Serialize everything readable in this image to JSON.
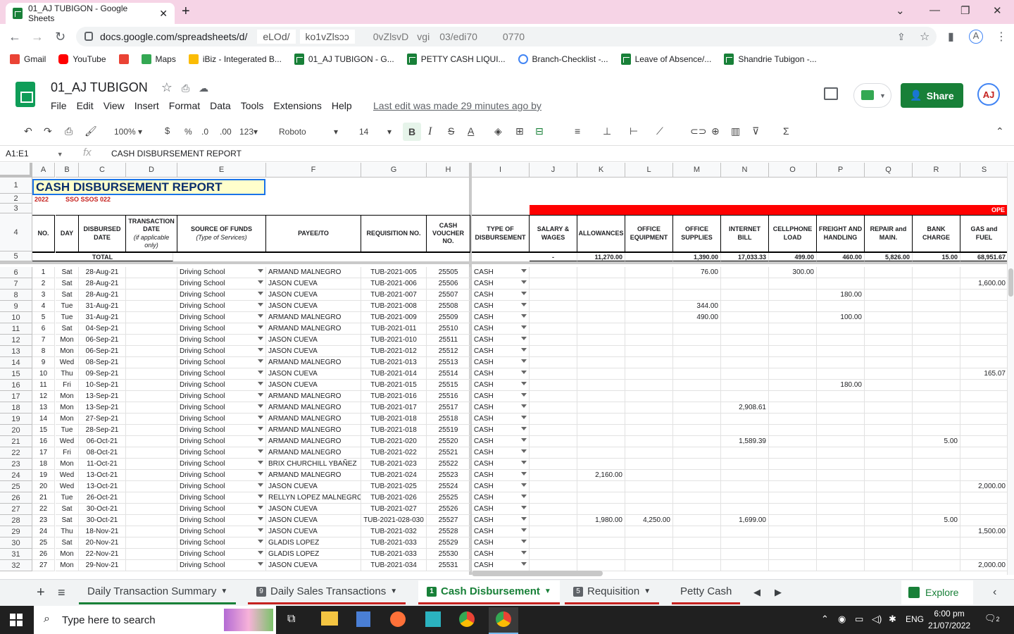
{
  "browser": {
    "tab_title": "01_AJ TUBIGON - Google Sheets",
    "url": "docs.google.com/spreadsheets/d/",
    "url_fragments": [
      "eLOd/",
      "ko1vZlsɔɔ",
      "0vZlsvD",
      "vgi",
      "03/edi70",
      "0770"
    ],
    "bookmarks": [
      "Gmail",
      "YouTube",
      "Maps",
      "iBiz - Integerated B...",
      "01_AJ TUBIGON - G...",
      "PETTY CASH LIQUI...",
      "Branch-Checklist -...",
      "Leave of Absence/...",
      "Shandrie Tubigon -..."
    ]
  },
  "doc": {
    "title": "01_AJ TUBIGON",
    "menus": [
      "File",
      "Edit",
      "View",
      "Insert",
      "Format",
      "Data",
      "Tools",
      "Extensions",
      "Help"
    ],
    "last_edit": "Last edit was made 29 minutes ago by",
    "share": "Share",
    "avatar": "AJ"
  },
  "toolbar": {
    "zoom": "100%",
    "currency": "$",
    "percent": "%",
    "dec_less": ".0",
    "dec_more": ".00",
    "format123": "123",
    "font": "Roboto",
    "size": "14"
  },
  "formula": {
    "namebox": "A1:E1",
    "fx": "fx",
    "content": "CASH DISBURSEMENT REPORT"
  },
  "columns": [
    "A",
    "B",
    "C",
    "D",
    "E",
    "F",
    "G",
    "H",
    "I",
    "J",
    "K",
    "L",
    "M",
    "N",
    "O",
    "P",
    "Q",
    "R",
    "S"
  ],
  "sheet": {
    "title": "CASH DISBURSEMENT REPORT",
    "row2": "2022",
    "row2b": "SSO SSOS 022",
    "ope": "OPE",
    "headers": {
      "no": "NO.",
      "day": "DAY",
      "disbursed": "DISBURSED DATE",
      "transaction": "TRANSACTION DATE",
      "transaction_note": "(if applicable only)",
      "source": "SOURCE OF FUNDS",
      "source_note": "(Type of Services)",
      "payee": "PAYEE/TO",
      "req": "REQUISITION NO.",
      "voucher": "CASH VOUCHER NO.",
      "type": "TYPE OF DISBURSEMENT",
      "salary": "SALARY & WAGES",
      "allow": "ALLOWANCES",
      "equip": "OFFICE EQUIPMENT",
      "supplies": "OFFICE SUPPLIES",
      "internet": "INTERNET BILL",
      "cell": "CELLPHONE LOAD",
      "freight": "FREIGHT AND HANDLING",
      "repair": "REPAIR and MAIN.",
      "bank": "BANK CHARGE",
      "gas": "GAS and FUEL"
    },
    "total_label": "TOTAL",
    "totals": {
      "J": "-",
      "K": "11,270.00",
      "L": "",
      "M": "1,390.00",
      "N": "17,033.33",
      "O": "499.00",
      "P": "460.00",
      "Q": "5,826.00",
      "R": "15.00",
      "S": "68,951.67"
    },
    "rows": [
      {
        "n": "6",
        "no": "1",
        "day": "Sat",
        "date": "28-Aug-21",
        "src": "Driving School",
        "payee": "ARMAND  MALNEGRO",
        "req": "TUB-2021-005",
        "cv": "25505",
        "type": "CASH",
        "M": "76.00",
        "O": "300.00"
      },
      {
        "n": "7",
        "no": "2",
        "day": "Sat",
        "date": "28-Aug-21",
        "src": "Driving School",
        "payee": "JASON CUEVA",
        "req": "TUB-2021-006",
        "cv": "25506",
        "type": "CASH",
        "S": "1,600.00"
      },
      {
        "n": "8",
        "no": "3",
        "day": "Sat",
        "date": "28-Aug-21",
        "src": "Driving School",
        "payee": "JASON CUEVA",
        "req": "TUB-2021-007",
        "cv": "25507",
        "type": "CASH",
        "P": "180.00"
      },
      {
        "n": "9",
        "no": "4",
        "day": "Tue",
        "date": "31-Aug-21",
        "src": "Driving School",
        "payee": "JASON CUEVA",
        "req": "TUB-2021-008",
        "cv": "25508",
        "type": "CASH",
        "M": "344.00"
      },
      {
        "n": "10",
        "no": "5",
        "day": "Tue",
        "date": "31-Aug-21",
        "src": "Driving School",
        "payee": "ARMAND MALNEGRO",
        "req": "TUB-2021-009",
        "cv": "25509",
        "type": "CASH",
        "M": "490.00",
        "P": "100.00"
      },
      {
        "n": "11",
        "no": "6",
        "day": "Sat",
        "date": "04-Sep-21",
        "src": "Driving School",
        "payee": "ARMAND MALNEGRO",
        "req": "TUB-2021-011",
        "cv": "25510",
        "type": "CASH"
      },
      {
        "n": "12",
        "no": "7",
        "day": "Mon",
        "date": "06-Sep-21",
        "src": "Driving School",
        "payee": "JASON CUEVA",
        "req": "TUB-2021-010",
        "cv": "25511",
        "type": "CASH"
      },
      {
        "n": "13",
        "no": "8",
        "day": "Mon",
        "date": "06-Sep-21",
        "src": "Driving School",
        "payee": "JASON CUEVA",
        "req": "TUB-2021-012",
        "cv": "25512",
        "type": "CASH"
      },
      {
        "n": "14",
        "no": "9",
        "day": "Wed",
        "date": "08-Sep-21",
        "src": "Driving School",
        "payee": "ARMAND MALNEGRO",
        "req": "TUB-2021-013",
        "cv": "25513",
        "type": "CASH"
      },
      {
        "n": "15",
        "no": "10",
        "day": "Thu",
        "date": "09-Sep-21",
        "src": "Driving School",
        "payee": "JASON CUEVA",
        "req": "TUB-2021-014",
        "cv": "25514",
        "type": "CASH",
        "S": "165.07"
      },
      {
        "n": "16",
        "no": "11",
        "day": "Fri",
        "date": "10-Sep-21",
        "src": "Driving School",
        "payee": "JASON CUEVA",
        "req": "TUB-2021-015",
        "cv": "25515",
        "type": "CASH",
        "P": "180.00"
      },
      {
        "n": "17",
        "no": "12",
        "day": "Mon",
        "date": "13-Sep-21",
        "src": "Driving School",
        "payee": "ARMAND MALNEGRO",
        "req": "TUB-2021-016",
        "cv": "25516",
        "type": "CASH"
      },
      {
        "n": "18",
        "no": "13",
        "day": "Mon",
        "date": "13-Sep-21",
        "src": "Driving School",
        "payee": "ARMAND MALNEGRO",
        "req": "TUB-2021-017",
        "cv": "25517",
        "type": "CASH",
        "N": "2,908.61"
      },
      {
        "n": "19",
        "no": "14",
        "day": "Mon",
        "date": "27-Sep-21",
        "src": "Driving School",
        "payee": "ARMAND MALNEGRO",
        "req": "TUB-2021-018",
        "cv": "25518",
        "type": "CASH"
      },
      {
        "n": "20",
        "no": "15",
        "day": "Tue",
        "date": "28-Sep-21",
        "src": "Driving School",
        "payee": "ARMAND MALNEGRO",
        "req": "TUB-2021-018",
        "cv": "25519",
        "type": "CASH"
      },
      {
        "n": "21",
        "no": "16",
        "day": "Wed",
        "date": "06-Oct-21",
        "src": "Driving School",
        "payee": "ARMAND MALNEGRO",
        "req": "TUB-2021-020",
        "cv": "25520",
        "type": "CASH",
        "N": "1,589.39",
        "R": "5.00"
      },
      {
        "n": "22",
        "no": "17",
        "day": "Fri",
        "date": "08-Oct-21",
        "src": "Driving School",
        "payee": "ARMAND MALNEGRO",
        "req": "TUB-2021-022",
        "cv": "25521",
        "type": "CASH"
      },
      {
        "n": "23",
        "no": "18",
        "day": "Mon",
        "date": "11-Oct-21",
        "src": "Driving School",
        "payee": "BRIX CHURCHILL YBAÑEZ",
        "req": "TUB-2021-023",
        "cv": "25522",
        "type": "CASH"
      },
      {
        "n": "24",
        "no": "19",
        "day": "Wed",
        "date": "13-Oct-21",
        "src": "Driving School",
        "payee": "ARMAND MALNEGRO",
        "req": "TUB-2021-024",
        "cv": "25523",
        "type": "CASH",
        "K": "2,160.00"
      },
      {
        "n": "25",
        "no": "20",
        "day": "Wed",
        "date": "13-Oct-21",
        "src": "Driving School",
        "payee": "JASON CUEVA",
        "req": "TUB-2021-025",
        "cv": "25524",
        "type": "CASH",
        "S": "2,000.00"
      },
      {
        "n": "26",
        "no": "21",
        "day": "Tue",
        "date": "26-Oct-21",
        "src": "Driving School",
        "payee": "RELLYN LOPEZ MALNEGRO",
        "req": "TUB-2021-026",
        "cv": "25525",
        "type": "CASH"
      },
      {
        "n": "27",
        "no": "22",
        "day": "Sat",
        "date": "30-Oct-21",
        "src": "Driving School",
        "payee": "JASON CUEVA",
        "req": "TUB-2021-027",
        "cv": "25526",
        "type": "CASH"
      },
      {
        "n": "28",
        "no": "23",
        "day": "Sat",
        "date": "30-Oct-21",
        "src": "Driving School",
        "payee": "JASON CUEVA",
        "req": "TUB-2021-028-030",
        "cv": "25527",
        "type": "CASH",
        "K": "1,980.00",
        "L": "4,250.00",
        "N": "1,699.00",
        "R": "5.00"
      },
      {
        "n": "29",
        "no": "24",
        "day": "Thu",
        "date": "18-Nov-21",
        "src": "Driving School",
        "payee": "JASON CUEVA",
        "req": "TUB-2021-032",
        "cv": "25528",
        "type": "CASH",
        "S": "1,500.00"
      },
      {
        "n": "30",
        "no": "25",
        "day": "Sat",
        "date": "20-Nov-21",
        "src": "Driving School",
        "payee": "GLADIS LOPEZ",
        "req": "TUB-2021-033",
        "cv": "25529",
        "type": "CASH"
      },
      {
        "n": "31",
        "no": "26",
        "day": "Mon",
        "date": "22-Nov-21",
        "src": "Driving School",
        "payee": "GLADIS LOPEZ",
        "req": "TUB-2021-033",
        "cv": "25530",
        "type": "CASH"
      },
      {
        "n": "32",
        "no": "27",
        "day": "Mon",
        "date": "29-Nov-21",
        "src": "Driving School",
        "payee": "JASON CUEVA",
        "req": "TUB-2021-034",
        "cv": "25531",
        "type": "CASH",
        "S": "2,000.00"
      }
    ]
  },
  "sheet_tabs": [
    {
      "label": "Daily Transaction Summary",
      "num": ""
    },
    {
      "label": "Daily Sales Transactions",
      "num": "9"
    },
    {
      "label": "Cash Disbursement",
      "num": "1"
    },
    {
      "label": "Requisition",
      "num": "5"
    },
    {
      "label": "Petty Cash",
      "num": ""
    }
  ],
  "explore": "Explore",
  "taskbar": {
    "search": "Type here to search",
    "lang": "ENG",
    "time": "6:00 pm",
    "date": "21/07/2022",
    "notif": "2"
  },
  "colors": {
    "accent": "#188038",
    "red_band": "#ff0000",
    "title_fill": "#ffffcc"
  }
}
